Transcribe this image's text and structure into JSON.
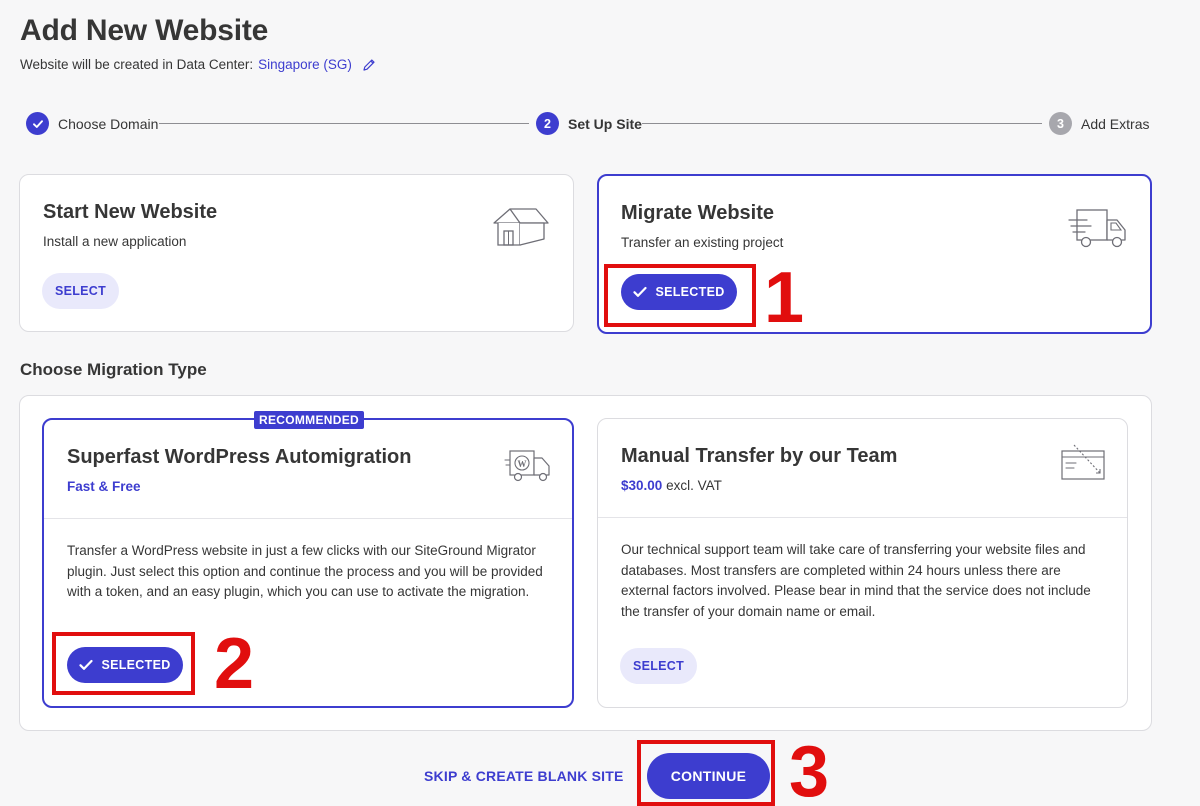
{
  "header": {
    "title": "Add New Website",
    "subtitle_prefix": "Website will be created in Data Center:",
    "data_center": "Singapore (SG)"
  },
  "stepper": {
    "steps": [
      {
        "number": "",
        "label": "Choose Domain",
        "state": "done"
      },
      {
        "number": "2",
        "label": "Set Up Site",
        "state": "active"
      },
      {
        "number": "3",
        "label": "Add Extras",
        "state": "todo"
      }
    ]
  },
  "site_options": {
    "start_new": {
      "title": "Start New Website",
      "description": "Install a new application",
      "button": "SELECT"
    },
    "migrate": {
      "title": "Migrate Website",
      "description": "Transfer an existing project",
      "button": "SELECTED"
    }
  },
  "migration": {
    "section_title": "Choose Migration Type",
    "automigration": {
      "badge": "RECOMMENDED",
      "title": "Superfast WordPress Automigration",
      "price_note": "Fast & Free",
      "description": "Transfer a WordPress website in just a few clicks with our SiteGround Migrator plugin. Just select this option and continue the process and you will be provided with a token, and an easy plugin, which you can use to activate the migration.",
      "button": "SELECTED"
    },
    "manual": {
      "title": "Manual Transfer by our Team",
      "price": "$30.00",
      "price_suffix": "excl. VAT",
      "description": "Our technical support team will take care of transferring your website files and databases. Most transfers are completed within 24 hours unless there are external factors involved. Please bear in mind that the service does not include the transfer of your domain name or email.",
      "button": "SELECT"
    }
  },
  "footer": {
    "skip_label": "SKIP & CREATE BLANK SITE",
    "continue_label": "CONTINUE"
  },
  "annotations": {
    "one": "1",
    "two": "2",
    "three": "3"
  },
  "colors": {
    "accent": "#3d3dcf",
    "accent_light": "#e9e9fb",
    "annotation_red": "#e10e0e",
    "text": "#363636",
    "background": "#f7f7f8"
  },
  "icons": [
    "check-icon",
    "pencil-icon",
    "house-icon",
    "truck-icon",
    "wordpress-truck-icon",
    "browser-window-icon"
  ]
}
